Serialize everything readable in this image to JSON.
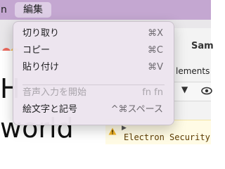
{
  "menubar": {
    "app_name_fragment": "n",
    "active_menu": "編集"
  },
  "edit_menu": {
    "items": [
      {
        "label": "切り取り",
        "shortcut": "⌘X",
        "enabled": true
      },
      {
        "label": "コピー",
        "shortcut": "⌘C",
        "enabled": true
      },
      {
        "label": "貼り付け",
        "shortcut": "⌘V",
        "enabled": true
      },
      {
        "label": "音声入力を開始",
        "shortcut": "fn fn",
        "enabled": false
      },
      {
        "label": "絵文字と記号",
        "shortcut": "^⌘スペース",
        "enabled": true
      }
    ]
  },
  "background_app": {
    "page_text_line1": "H",
    "page_text_line2": "world",
    "devtools_title_fragment": "Sam",
    "devtools_tab_fragment": "lements",
    "toolbar_caret": "▼",
    "console_caret": "▶",
    "console_warning_text": "Electron Security"
  },
  "colors": {
    "menubar_bg": "#c4a7d1",
    "warning_icon": "#f0b429"
  }
}
